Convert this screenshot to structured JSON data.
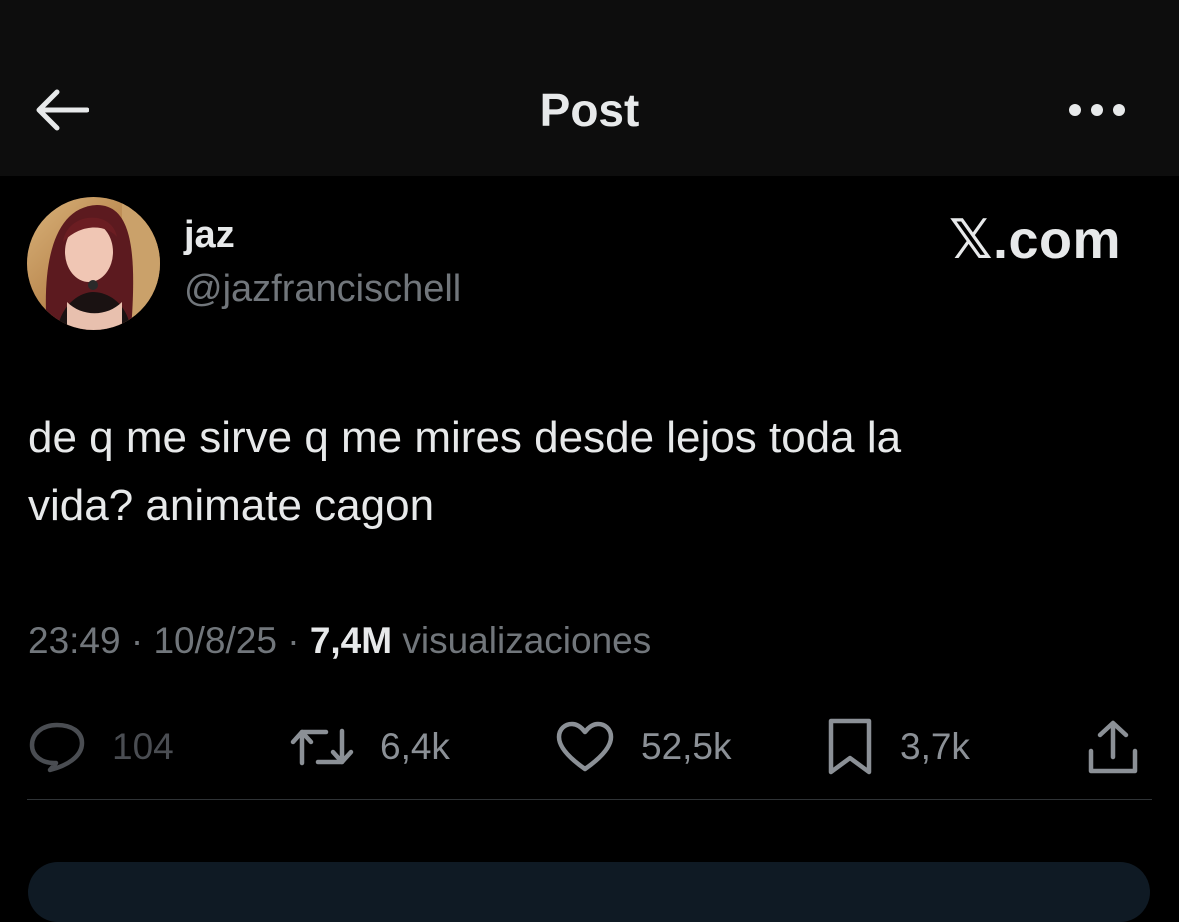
{
  "header": {
    "title": "Post",
    "back_icon": "arrow-left-icon",
    "more_icon": "more-horizontal-icon"
  },
  "author": {
    "name": "jaz",
    "handle": "@jazfrancischell"
  },
  "brand": "𝕏.com",
  "tweet": {
    "line1": "de q me sirve q me mires desde lejos toda la",
    "line2": "vida? animate cagon"
  },
  "meta": {
    "time": "23:49",
    "sep1": " · ",
    "date": "10/8/25",
    "sep2": " · ",
    "views": "7,4M",
    "views_label": " visualizaciones"
  },
  "actions": {
    "replies": "104",
    "reposts": "6,4k",
    "likes": "52,5k",
    "bookmarks": "3,7k"
  },
  "colors": {
    "background": "#000000",
    "header_bg": "#0d0d0d",
    "primary_text": "#e7e9ea",
    "secondary_text": "#71767b"
  }
}
